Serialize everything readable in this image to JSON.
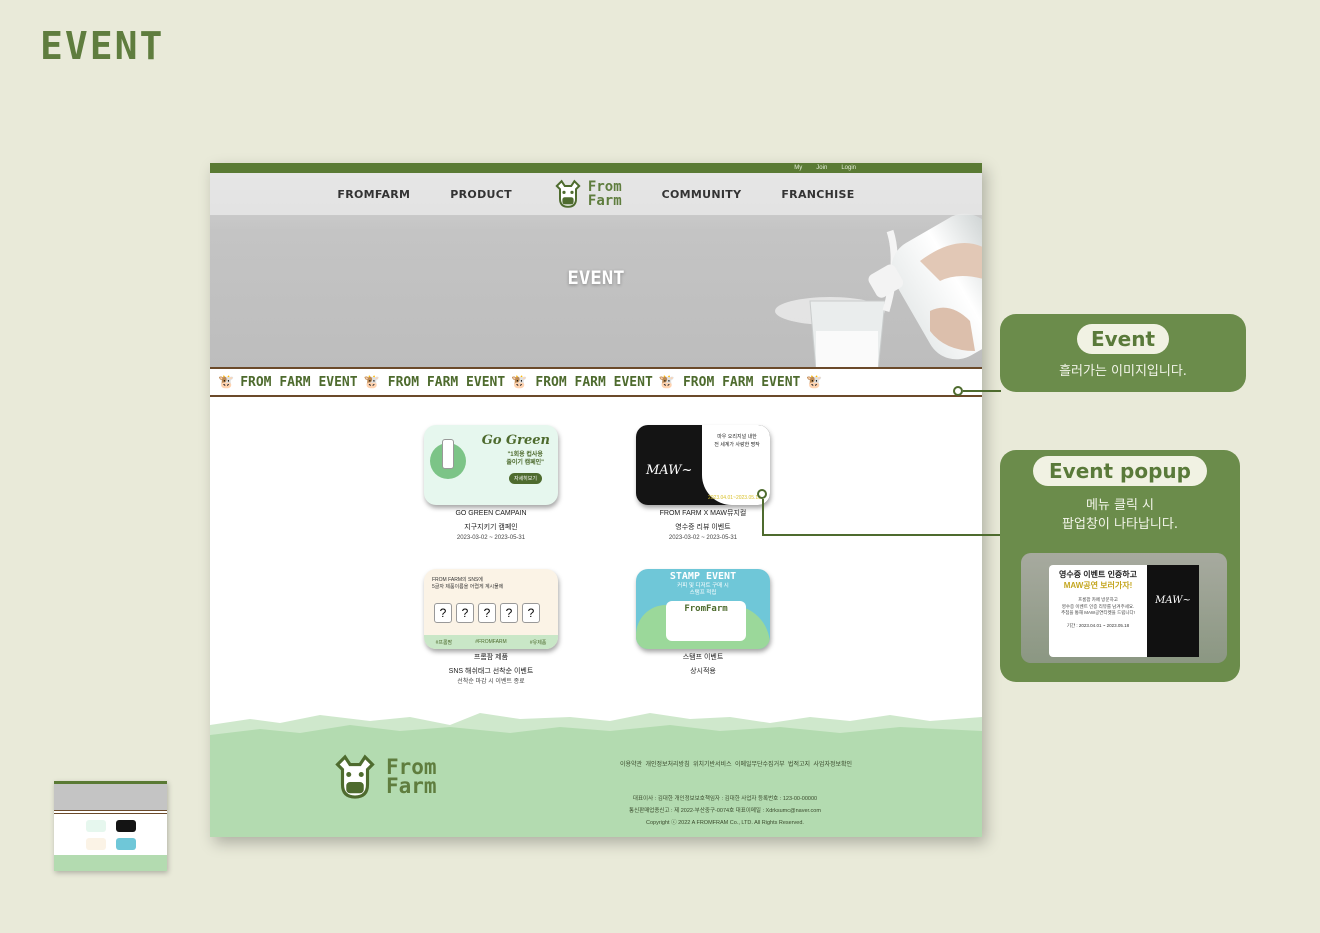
{
  "page_heading": "EVENT",
  "site": {
    "topbar": [
      "My",
      "Join",
      "Login"
    ],
    "nav": [
      "FROMFARM",
      "PRODUCT",
      "COMMUNITY",
      "FRANCHISE"
    ],
    "logo_text": [
      "From",
      "Farm"
    ],
    "hero_title": "EVENT",
    "marquee_text": "FROM FARM EVENT"
  },
  "cards": [
    {
      "name": "GO GREEN CAMPAIN",
      "subtitle": "지구지키기 캠페인",
      "date": "2023-03-02 ~ 2023-05-31",
      "img_title": "Go Green",
      "img_lines": [
        "\"1회용 컵사용",
        "줄이기 캠페인\""
      ],
      "img_button": "자세히보기"
    },
    {
      "name": "FROM FARM X MAW뮤지컬",
      "subtitle": "영수증 리뷰 이벤트",
      "date": "2023-03-02 ~ 2023-05-31",
      "img_title": "MAW~",
      "img_lines": [
        "마우 오리지널 내한",
        "전 세계가 사랑한 명작",
        "2023.04.01~2023.05.18"
      ]
    },
    {
      "name": "프롬팜 제품",
      "subtitle": "SNS 해쉬태그 선착순 이벤트",
      "date": "선착순 마감 시 이벤트 종료",
      "img_lines": [
        "FROM FARM의 SNS에",
        "5글자 제품이름을 어렵게 계시물에"
      ],
      "img_boxes": [
        "?",
        "?",
        "?",
        "?",
        "?"
      ],
      "img_tags": [
        "#프롬팜",
        "#FROMFARM",
        "#유제품"
      ]
    },
    {
      "name": "스탬프 이벤트",
      "subtitle": "상시적용",
      "date": "",
      "img_title": "STAMP EVENT",
      "img_lines": [
        "커피 및 디저트 구매 시",
        "스탬프 적립"
      ],
      "img_logo": "FromFarm"
    }
  ],
  "footer": {
    "links": [
      "이용약관",
      "개인정보처리방침",
      "위치기반서비스",
      "이메일무단수집거부",
      "법적고지",
      "사업자정보확인"
    ],
    "info": [
      "대표이사 : 김대한 개인정보보호책임자 : 김대한 사업자 등록번호 : 123-00-00000",
      "통신판매업종신고 : 제 2022-부산중구-0074호 대표이메일 : Xdrksumc@naver.com",
      "Copyright ⓒ 2022 A FROMFRAM Co., LTD. All Rights Reserved."
    ]
  },
  "callouts": {
    "event": {
      "title": "Event",
      "desc": "흘러가는 이미지입니다."
    },
    "popup": {
      "title": "Event popup",
      "desc_line1": "메뉴 클릭 시",
      "desc_line2": "팝업창이 나타납니다.",
      "popup_title_1": "영수증 이벤트 인증하고",
      "popup_title_2": "MAW공연 보러가자!",
      "popup_lines": [
        "프롬팜 카페 방문하고",
        "영수증 이벤트 인증 리뷰를 남겨주세요.",
        "추첨을 통해 MAW공연티켓을 드립니다!"
      ],
      "popup_date": "기간 : 2023.04.01 ~ 2023.05.18",
      "popup_side": "MAW~"
    }
  },
  "colors": {
    "accent": "#5a7a34",
    "background": "#e9ead9",
    "callout": "#6b8c4b",
    "footer": "#b3dbb0"
  }
}
